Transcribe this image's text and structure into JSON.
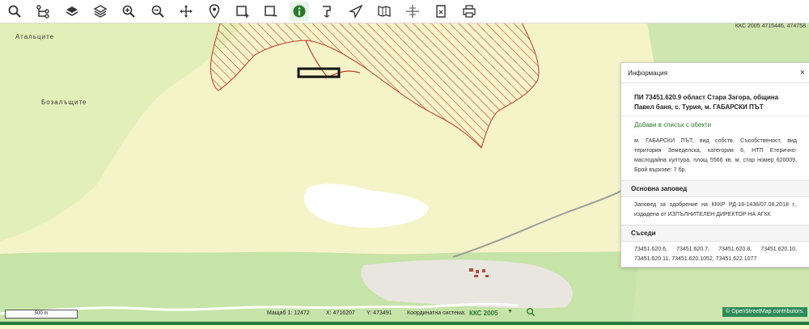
{
  "toolbar": {
    "icons": [
      "search-icon",
      "tree-icon",
      "layers-icon",
      "layers-stack-icon",
      "zoom-in-icon",
      "zoom-out-icon",
      "pan-icon",
      "pin-icon",
      "select-area-icon",
      "select-rect-icon",
      "info-icon",
      "route-icon",
      "plane-icon",
      "book-icon",
      "grid-icon",
      "document-icon",
      "print-icon"
    ]
  },
  "map": {
    "coord_top": "ККС 2005 4715446, 474758",
    "places": [
      "Атальците",
      "Бозалъщите"
    ]
  },
  "panel": {
    "header": "Информация",
    "close": "×",
    "title": "ПИ 73451.620.9 област Стара Загора, община Павел баня, с. Турия, м. ГАБАРСКИ ПЪТ",
    "add_link": "Добави в списък с обекти",
    "description": "м. ГАБАРСКИ ПЪТ, вид собств. Съсобственост, вид територия Земеделска, категория 6, НТП Етерично-маслодайна култура, площ 5566 кв. м, стар номер 620009, Брой върхове: 7 бр.",
    "sections": [
      {
        "title": "Основна заповед",
        "text": "Заповед за одобрение на КККР РД-18-1438/07.08.2018 г., издадена от ИЗПЪЛНИТЕЛЕН ДИРЕКТОР НА АГКК"
      },
      {
        "title": "Съседи",
        "text": "73451.620.6, 73451.620.7, 73451.620.8, 73451.620.10, 73451.620.11, 73451.620.1052, 73451.622.1077"
      }
    ]
  },
  "status": {
    "scale_label": "500 m",
    "scale_text": "Мащаб 1:  12472",
    "x_text": "X:  4716207",
    "y_text": "Y:  473491",
    "coord_system_label": "Координатна система:",
    "coord_system_value": "ККС 2005",
    "osm": "© OpenStreetMap contributors."
  },
  "colors": {
    "green": "#2a7a2a",
    "hatch": "#c0392b",
    "agri": "#f4f4c8",
    "forest": "#bfe0a4"
  }
}
